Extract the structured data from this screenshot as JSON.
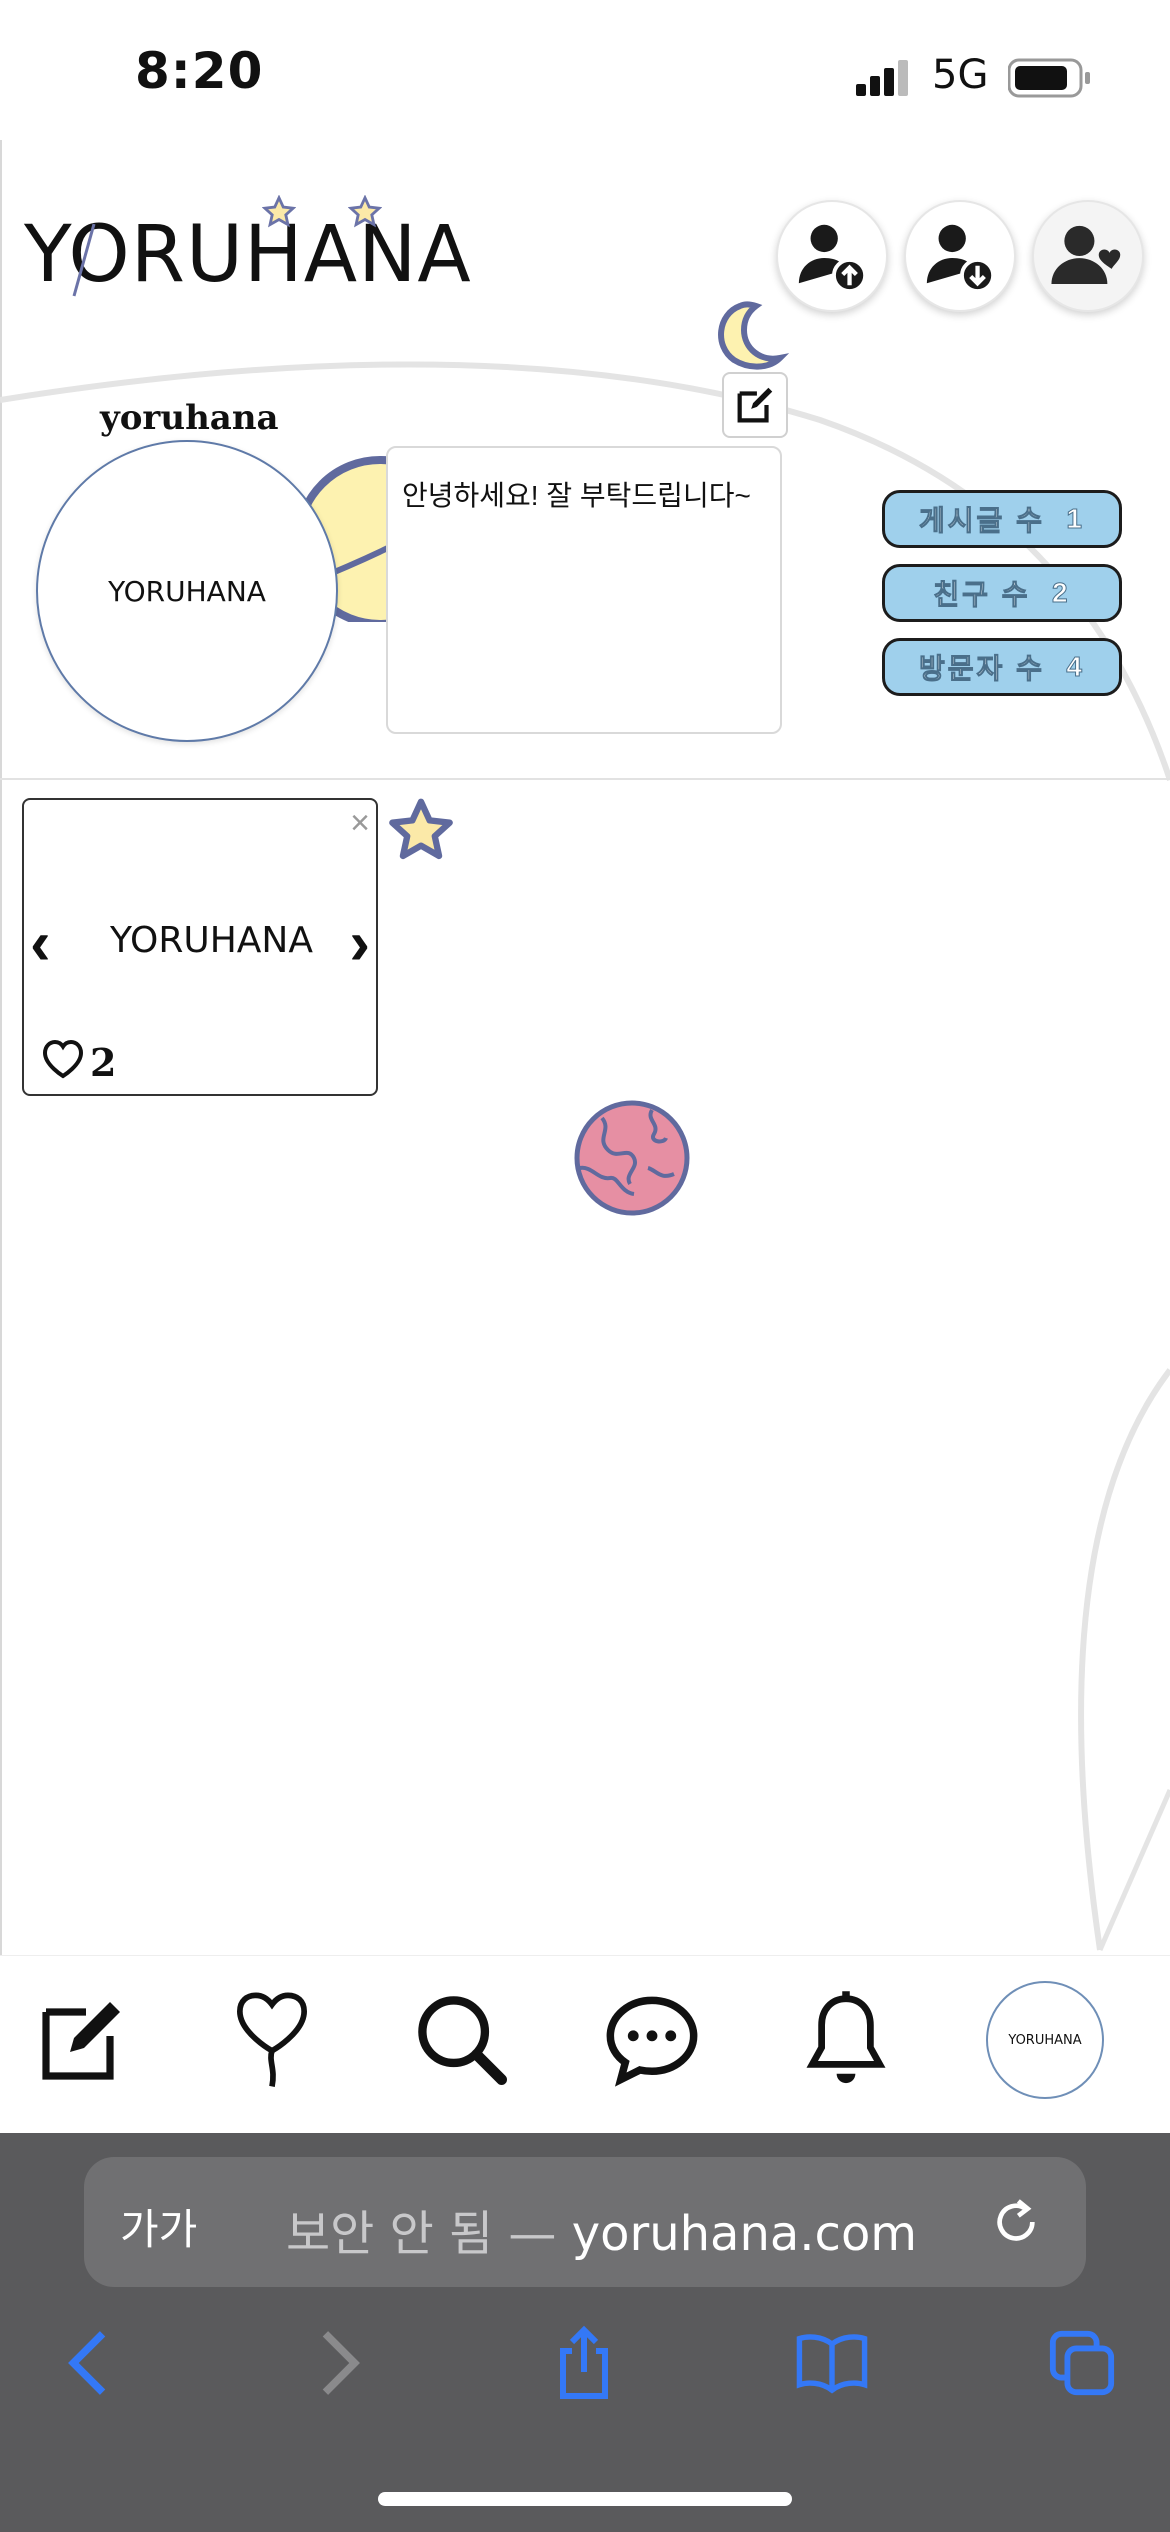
{
  "status_bar": {
    "time": "8:20",
    "network": "5G"
  },
  "header": {
    "logo_text": "YORUHANA",
    "buttons": [
      {
        "name": "follow-upload",
        "icon": "user-arrow-up-icon"
      },
      {
        "name": "follow-download",
        "icon": "user-arrow-down-icon"
      },
      {
        "name": "profile-heart",
        "icon": "user-heart-icon"
      }
    ]
  },
  "profile": {
    "username": "yoruhana",
    "avatar_logo": "YORUHANA",
    "bio": "안녕하세요! 잘 부탁드립니다~",
    "edit_icon": "edit-icon"
  },
  "stats": [
    {
      "label": "게시글 수",
      "value": "1"
    },
    {
      "label": "친구 수",
      "value": "2"
    },
    {
      "label": "방문자 수",
      "value": "4"
    }
  ],
  "post": {
    "image_logo": "YORUHANA",
    "close_symbol": "×",
    "prev_symbol": "‹",
    "next_symbol": "›",
    "likes": "2"
  },
  "bottom_nav": [
    {
      "name": "write",
      "icon": "pencil-square-icon"
    },
    {
      "name": "likes",
      "icon": "heart-balloon-icon"
    },
    {
      "name": "search",
      "icon": "search-icon"
    },
    {
      "name": "messages",
      "icon": "chat-bubble-icon"
    },
    {
      "name": "notifications",
      "icon": "bell-icon"
    },
    {
      "name": "profile",
      "icon": "avatar-icon",
      "logo": "YORUHANA"
    }
  ],
  "browser": {
    "aa_label": "가가",
    "security_text": "보안 안 됨 —",
    "domain": "yoruhana.com",
    "accent": "#3478f6"
  },
  "colors": {
    "pill_bg": "#9fd0ec",
    "moon": "#fdf2b0",
    "planet": "#e68fa3",
    "outline": "#606a9e"
  }
}
